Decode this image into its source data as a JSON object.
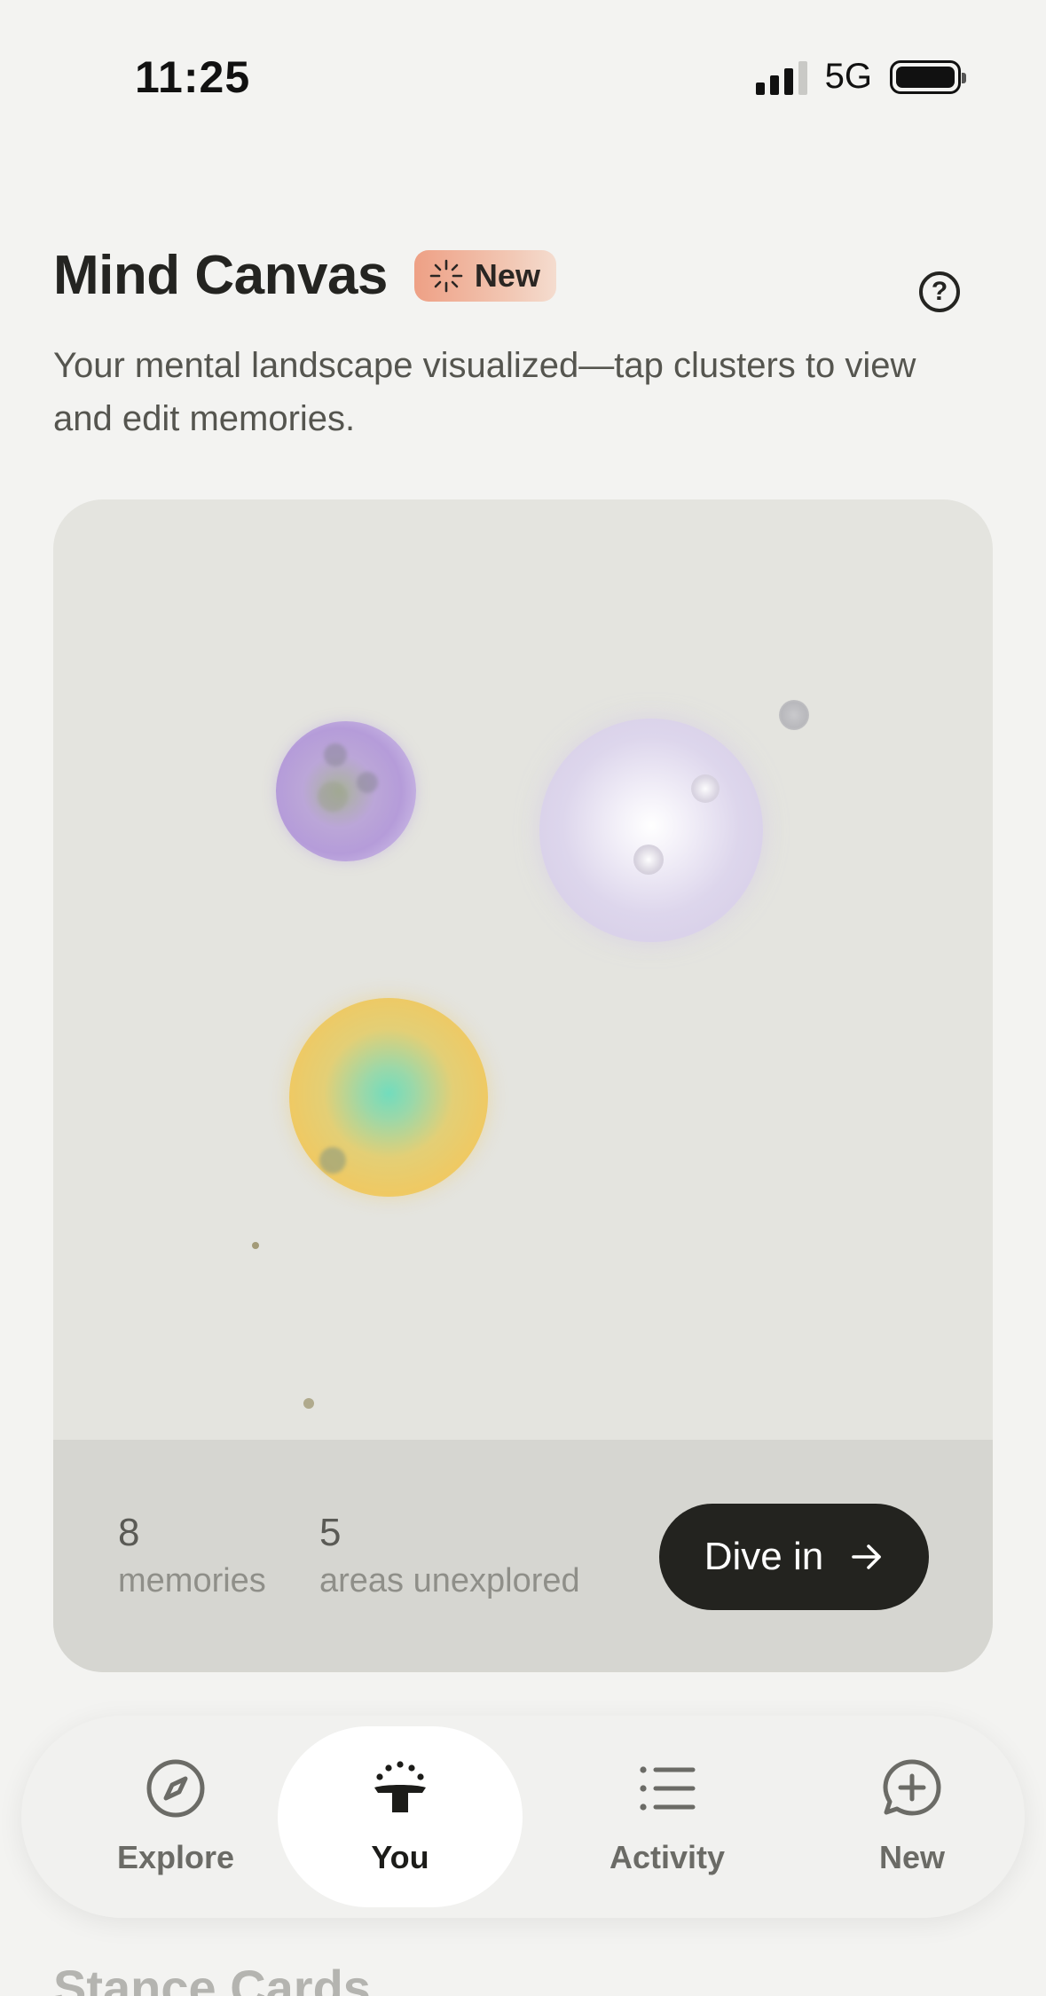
{
  "status_bar": {
    "time": "11:25",
    "network": "5G"
  },
  "header": {
    "title": "Mind Canvas",
    "badge": "New",
    "subtitle": "Your mental landscape visualized—tap clusters to view and edit memories."
  },
  "canvas": {
    "stats": [
      {
        "value": "8",
        "label": "memories"
      },
      {
        "value": "5",
        "label": "areas unexplored"
      }
    ],
    "cta": "Dive in"
  },
  "nav": {
    "tabs": [
      {
        "label": "Explore",
        "icon": "compass-icon",
        "active": false
      },
      {
        "label": "You",
        "icon": "person-icon",
        "active": true
      },
      {
        "label": "Activity",
        "icon": "list-icon",
        "active": false
      },
      {
        "label": "New",
        "icon": "chat-plus-icon",
        "active": false
      }
    ]
  },
  "next_section": {
    "title": "Stance Cards"
  },
  "colors": {
    "background": "#f3f3f1",
    "card": "#e4e4df",
    "stats_bar": "#d6d6d1",
    "button": "#23231f",
    "badge_start": "#eea085",
    "cluster_purple": "#b49ad6",
    "cluster_lavender": "#d9d0ea",
    "cluster_yellow": "#efcb66",
    "cluster_teal": "#6fd6b8"
  }
}
